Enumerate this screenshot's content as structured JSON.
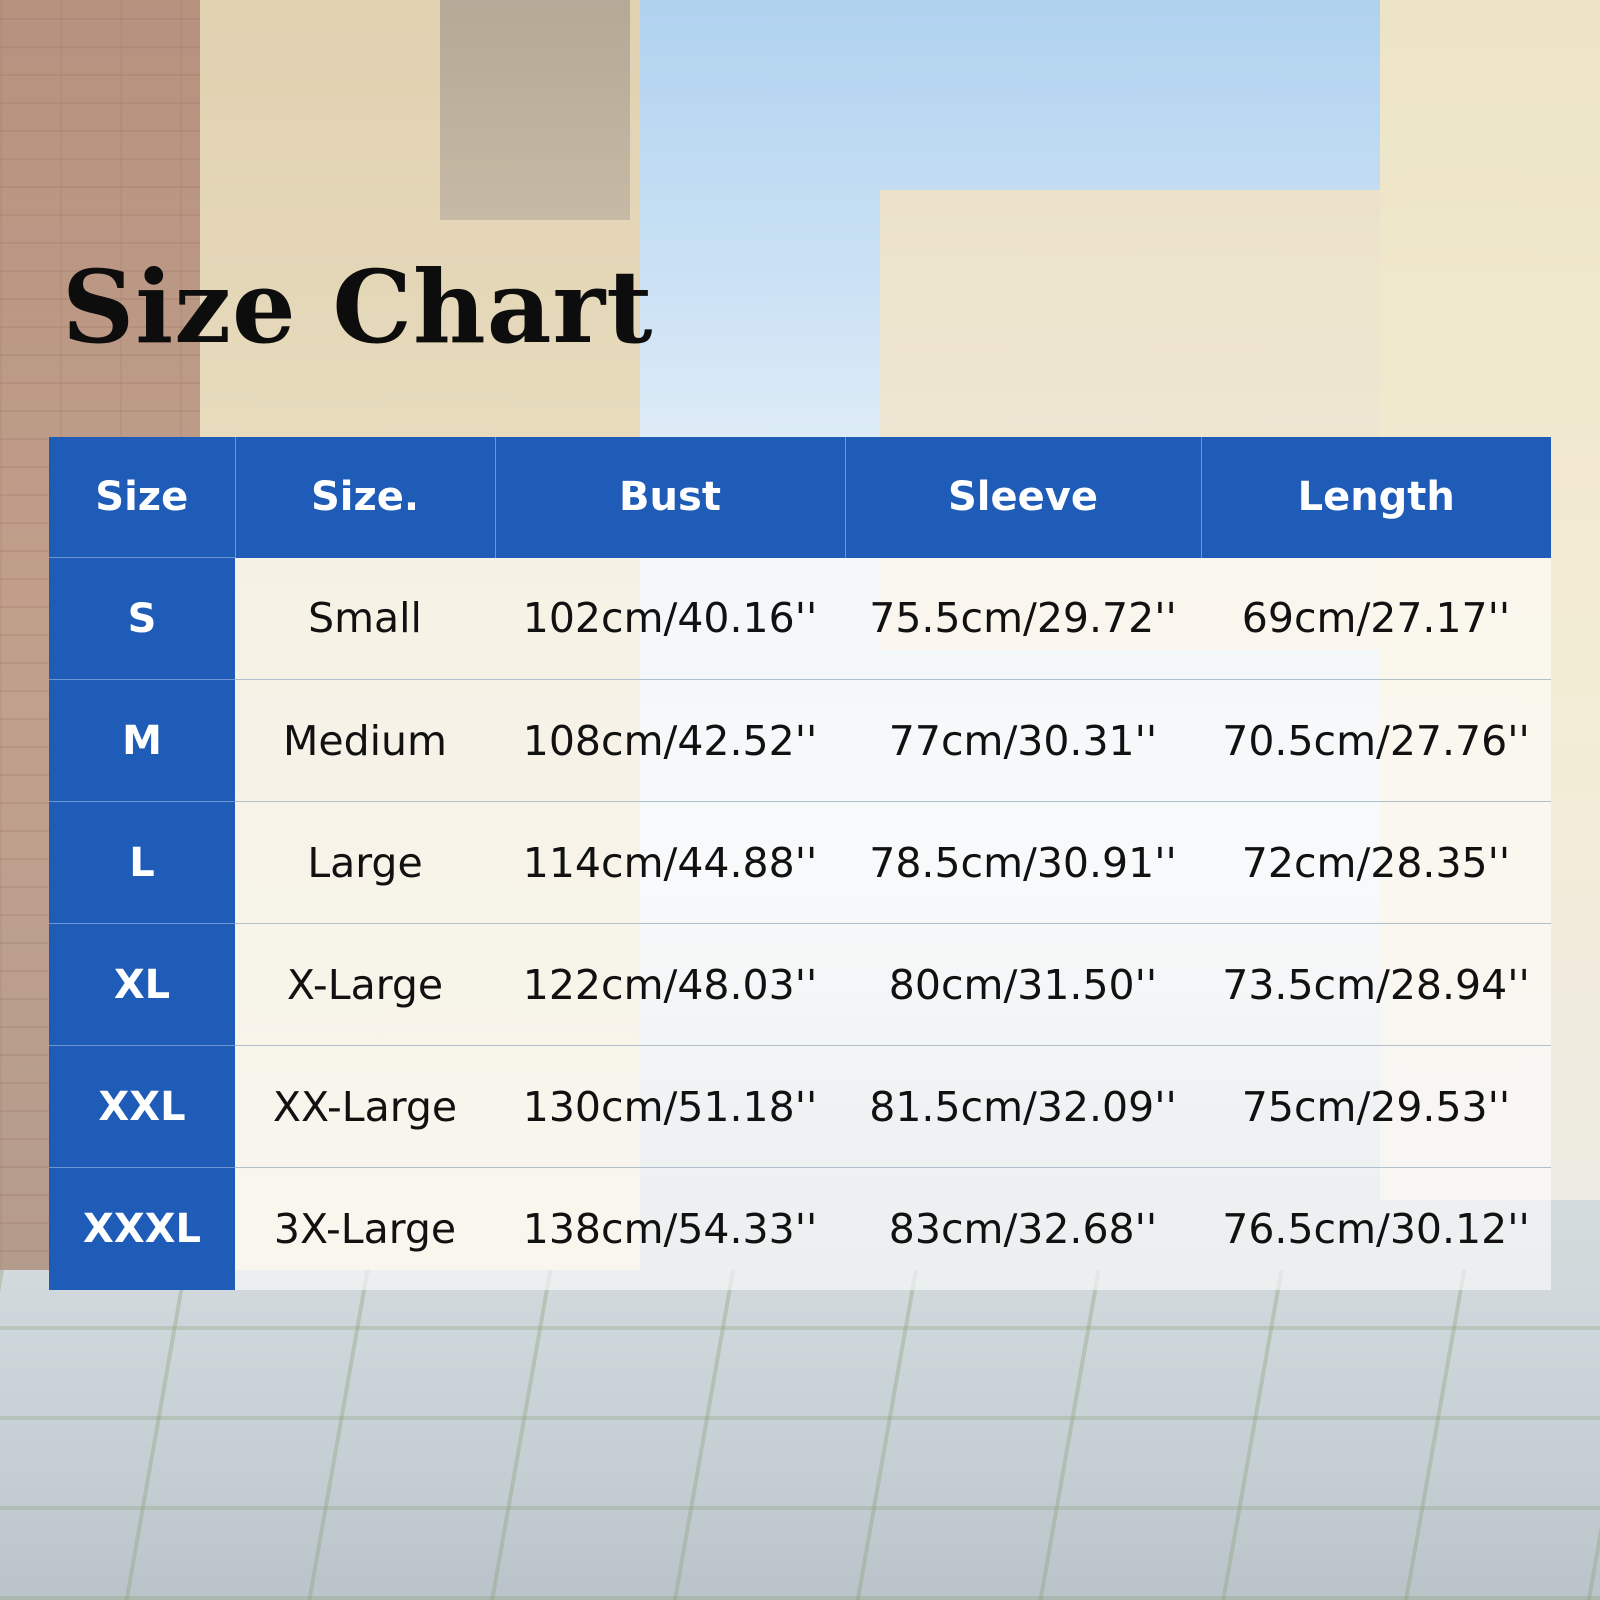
{
  "title": "Size Chart",
  "colors": {
    "header_blue": "#1f5cb8",
    "title_text": "#0d0d0d",
    "cell_text": "#111111"
  },
  "table": {
    "headers": [
      "Size",
      "Size.",
      "Bust",
      "Sleeve",
      "Length"
    ],
    "rows": [
      {
        "size": "S",
        "name": "Small",
        "bust": "102cm/40.16''",
        "sleeve": "75.5cm/29.72''",
        "length": "69cm/27.17''"
      },
      {
        "size": "M",
        "name": "Medium",
        "bust": "108cm/42.52''",
        "sleeve": "77cm/30.31''",
        "length": "70.5cm/27.76''"
      },
      {
        "size": "L",
        "name": "Large",
        "bust": "114cm/44.88''",
        "sleeve": "78.5cm/30.91''",
        "length": "72cm/28.35''"
      },
      {
        "size": "XL",
        "name": "X-Large",
        "bust": "122cm/48.03''",
        "sleeve": "80cm/31.50''",
        "length": "73.5cm/28.94''"
      },
      {
        "size": "XXL",
        "name": "XX-Large",
        "bust": "130cm/51.18''",
        "sleeve": "81.5cm/32.09''",
        "length": "75cm/29.53''"
      },
      {
        "size": "XXXL",
        "name": "3X-Large",
        "bust": "138cm/54.33''",
        "sleeve": "83cm/32.68''",
        "length": "76.5cm/30.12''"
      }
    ]
  }
}
